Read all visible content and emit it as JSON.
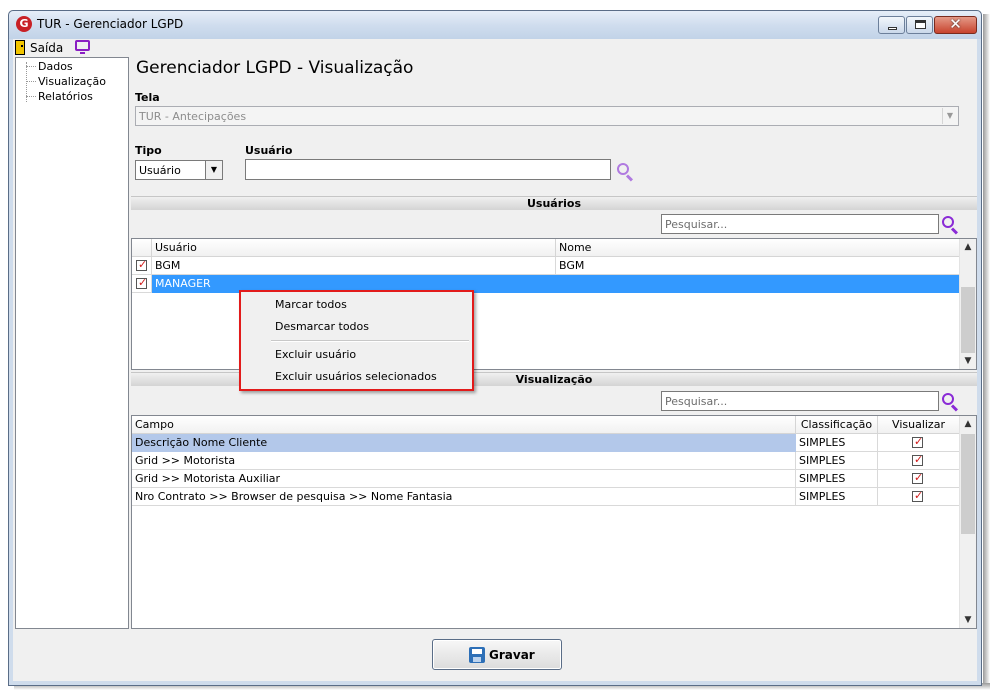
{
  "window": {
    "title": "TUR - Gerenciador LGPD",
    "logo": "G"
  },
  "toolbar": {
    "exit_label": "Saída"
  },
  "sidebar": {
    "items": [
      {
        "label": "Dados"
      },
      {
        "label": "Visualização"
      },
      {
        "label": "Relatórios"
      }
    ]
  },
  "page": {
    "title": "Gerenciador LGPD - Visualização"
  },
  "tela": {
    "label": "Tela",
    "value": "TUR - Antecipações"
  },
  "tipo": {
    "label": "Tipo",
    "value": "Usuário"
  },
  "usuario": {
    "label": "Usuário",
    "value": ""
  },
  "usuarios_section": {
    "title": "Usuários",
    "search_placeholder": "Pesquisar...",
    "columns": {
      "usuario": "Usuário",
      "nome": "Nome"
    },
    "rows": [
      {
        "usuario": "BGM",
        "nome": "BGM",
        "checked": true
      },
      {
        "usuario": "MANAGER",
        "nome": "",
        "checked": true,
        "selected": true
      }
    ]
  },
  "context_menu": {
    "items": [
      "Marcar todos",
      "Desmarcar todos",
      "Excluir usuário",
      "Excluir usuários selecionados"
    ]
  },
  "visualizacao_section": {
    "title": "Visualização",
    "search_placeholder": "Pesquisar...",
    "columns": {
      "campo": "Campo",
      "classificacao": "Classificação",
      "visualizar": "Visualizar"
    },
    "rows": [
      {
        "campo": "Descrição Nome Cliente",
        "classificacao": "SIMPLES",
        "visualizar": true
      },
      {
        "campo": "Grid >> Motorista",
        "classificacao": "SIMPLES",
        "visualizar": true
      },
      {
        "campo": "Grid >> Motorista Auxiliar",
        "classificacao": "SIMPLES",
        "visualizar": true
      },
      {
        "campo": "Nro Contrato >> Browser de pesquisa >> Nome Fantasia",
        "classificacao": "SIMPLES",
        "visualizar": true
      }
    ]
  },
  "footer": {
    "save_label": "Gravar"
  },
  "colors": {
    "accent": "#3399ff",
    "check": "#d11a1a",
    "search_icon": "#8a2bd6",
    "menu_border": "#e21b1b"
  }
}
